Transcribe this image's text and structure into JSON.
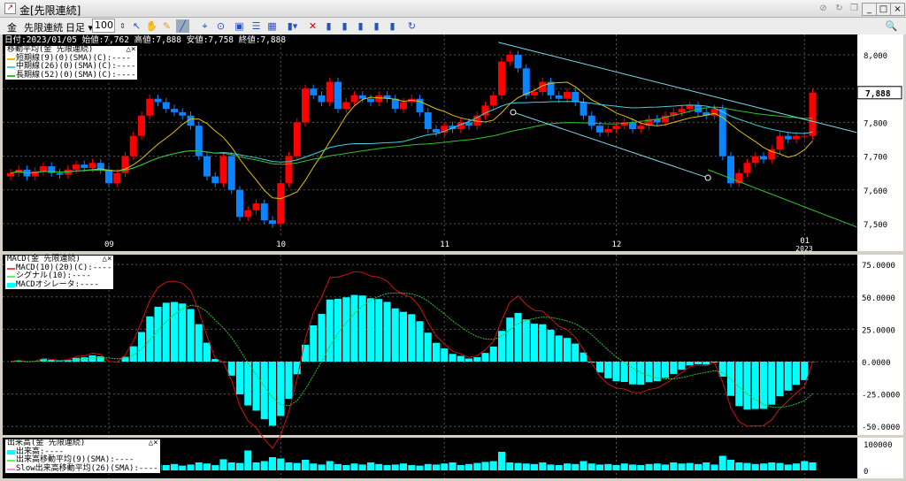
{
  "window": {
    "title": "金[先限連続]",
    "buttons": [
      "pin",
      "refresh",
      "restore-child",
      "minimize",
      "maximize",
      "close"
    ]
  },
  "toolbar": {
    "commodity": "金",
    "contract": "先限連続",
    "period": "日足",
    "count": "100"
  },
  "info_line": "日付:2023/01/05 始値:7,762 高値:7,888 安値:7,758 終値:7,888",
  "current_price": "7,888",
  "colors": {
    "up": "#ff0000",
    "down": "#0a84ff",
    "ma_short": "#e0c000",
    "ma_mid": "#40d0e0",
    "ma_long": "#30c030",
    "macd": "#d01010",
    "signal": "#30c030",
    "osc": "#00ffff",
    "trend": "#7fd8ea"
  },
  "ma_legend": {
    "title": "移動平均(金 先限連続)",
    "items": [
      "短期線(9)(0)(SMA)(C):----",
      "中期線(26)(0)(SMA)(C):----",
      "長期線(52)(0)(SMA)(C):----"
    ]
  },
  "macd_legend": {
    "title": "MACD(金 先限連続)",
    "items": [
      "MACD(10)(20)(C):----",
      "シグナル(10):----",
      "MACDオシレータ:----"
    ]
  },
  "vol_legend": {
    "title": "出来高(金 先限連続)",
    "items": [
      "出来高:----",
      "出来高移動平均(9)(SMA):----",
      "Slow出来高移動平均(26)(SMA):----"
    ]
  },
  "price_axis": {
    "ticks": [
      8000,
      7900,
      7800,
      7700,
      7600,
      7500
    ],
    "labels": [
      "8,000",
      "7,900",
      "7,800",
      "7,700",
      "7,600",
      "7,500"
    ]
  },
  "macd_axis": {
    "ticks": [
      75,
      50,
      25,
      0,
      -25,
      -50
    ],
    "labels": [
      "75.0000",
      "50.0000",
      "25.0000",
      "0.0000",
      "-25.0000",
      "-50.0000"
    ]
  },
  "vol_axis": {
    "ticks": [
      100000,
      0
    ],
    "labels": [
      "100000",
      "0"
    ]
  },
  "date_axis": [
    {
      "label": "09",
      "index": 12
    },
    {
      "label": "10",
      "index": 33
    },
    {
      "label": "11",
      "index": 53
    },
    {
      "label": "12",
      "index": 74
    },
    {
      "label": "01",
      "sub": "2023",
      "index": 97
    }
  ],
  "chart_data": {
    "type": "candlestick",
    "first_open": 7640,
    "closes": [
      7650,
      7660,
      7640,
      7655,
      7670,
      7650,
      7645,
      7660,
      7675,
      7665,
      7680,
      7660,
      7620,
      7650,
      7700,
      7760,
      7820,
      7870,
      7860,
      7840,
      7830,
      7820,
      7790,
      7700,
      7640,
      7620,
      7700,
      7600,
      7520,
      7540,
      7560,
      7510,
      7500,
      7620,
      7700,
      7800,
      7900,
      7880,
      7860,
      7920,
      7840,
      7860,
      7880,
      7870,
      7860,
      7880,
      7870,
      7840,
      7860,
      7870,
      7830,
      7780,
      7770,
      7790,
      7780,
      7800,
      7790,
      7820,
      7850,
      7880,
      7980,
      8000,
      7960,
      7880,
      7890,
      7920,
      7880,
      7870,
      7890,
      7860,
      7820,
      7790,
      7770,
      7780,
      7790,
      7800,
      7780,
      7790,
      7810,
      7800,
      7820,
      7830,
      7840,
      7850,
      7830,
      7820,
      7840,
      7700,
      7620,
      7650,
      7680,
      7700,
      7690,
      7720,
      7760,
      7750,
      7760,
      7760,
      7888
    ],
    "volumes": [
      22000,
      18000,
      25000,
      20000,
      15000,
      18000,
      24000,
      20000,
      30000,
      22000,
      18000,
      26000,
      35000,
      20000,
      28000,
      30000,
      25000,
      40000,
      22000,
      20000,
      24000,
      18000,
      22000,
      30000,
      26000,
      20000,
      42000,
      30000,
      28000,
      75000,
      30000,
      35000,
      50000,
      45000,
      30000,
      28000,
      40000,
      26000,
      22000,
      35000,
      24000,
      20000,
      26000,
      22000,
      30000,
      24000,
      20000,
      22000,
      26000,
      20000,
      18000,
      24000,
      22000,
      26000,
      30000,
      20000,
      24000,
      28000,
      32000,
      35000,
      70000,
      30000,
      28000,
      26000,
      24000,
      30000,
      22000,
      20000,
      26000,
      24000,
      35000,
      26000,
      22000,
      24000,
      20000,
      26000,
      22000,
      20000,
      24000,
      26000,
      22000,
      30000,
      26000,
      28000,
      24000,
      30000,
      22000,
      55000,
      40000,
      30000,
      28000,
      24000,
      26000,
      30000,
      28000,
      22000,
      26000,
      35000,
      30000
    ],
    "ma_periods": [
      9,
      26,
      52
    ],
    "macd_params": {
      "fast": 10,
      "slow": 20,
      "signal": 10
    },
    "price_range": [
      7470,
      8060
    ],
    "trendlines": [
      {
        "from": [
          59.6,
          8037
        ],
        "to": [
          103.4,
          7770
        ],
        "color": "trend"
      },
      {
        "from": [
          61.4,
          7830
        ],
        "to": [
          85.2,
          7636
        ],
        "color": "trend",
        "handles": true
      },
      {
        "from": [
          85.2,
          7660
        ],
        "to": [
          103.4,
          7490
        ],
        "color": "ma_long"
      }
    ]
  }
}
